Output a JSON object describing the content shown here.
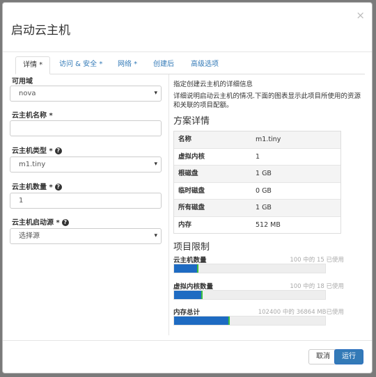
{
  "dialog": {
    "title": "启动云主机",
    "close": "×"
  },
  "tabs": [
    "详情 *",
    "访问 & 安全 *",
    "网络 *",
    "创建后",
    "高级选项"
  ],
  "form": {
    "az_label": "可用域",
    "az_value": "nova",
    "name_label": "云主机名称",
    "name_required": " *",
    "name_value": "",
    "flavor_label": "云主机类型",
    "flavor_required": " *",
    "flavor_value": "m1.tiny",
    "count_label": "云主机数量",
    "count_required": " *",
    "count_value": "1",
    "source_label": "云主机启动源",
    "source_required": "  *",
    "source_value": "选择源",
    "help_glyph": "?",
    "caret": "▾"
  },
  "info": {
    "heading": "指定创建云主机的详细信息",
    "description": "详细说明启动云主机的情况.下面的图表显示此项目所使用的资源和关联的项目配额。"
  },
  "flavor_details": {
    "title": "方案详情",
    "rows": [
      {
        "key": "名称",
        "value": "m1.tiny"
      },
      {
        "key": "虚拟内核",
        "value": "1"
      },
      {
        "key": "根磁盘",
        "value": "1 GB"
      },
      {
        "key": "临时磁盘",
        "value": "0 GB"
      },
      {
        "key": "所有磁盘",
        "value": "1 GB"
      },
      {
        "key": "内存",
        "value": "512 MB"
      }
    ]
  },
  "limits": {
    "title": "项目限制",
    "items": [
      {
        "label": "云主机数量",
        "text": "100 中的 15 已使用",
        "used": 15,
        "total": 100
      },
      {
        "label": "虚拟内核数量",
        "text": "100 中的 18 已使用",
        "used": 18,
        "total": 100
      },
      {
        "label": "内存总计",
        "text": "102400 中的 36864 MB已使用",
        "used": 36864,
        "total": 102400
      }
    ]
  },
  "footer": {
    "cancel": "取消",
    "launch": "运行"
  },
  "colors": {
    "accent": "#337ab7",
    "bar_fill": "#1e6bc2",
    "bar_edge": "#3ec13e"
  }
}
